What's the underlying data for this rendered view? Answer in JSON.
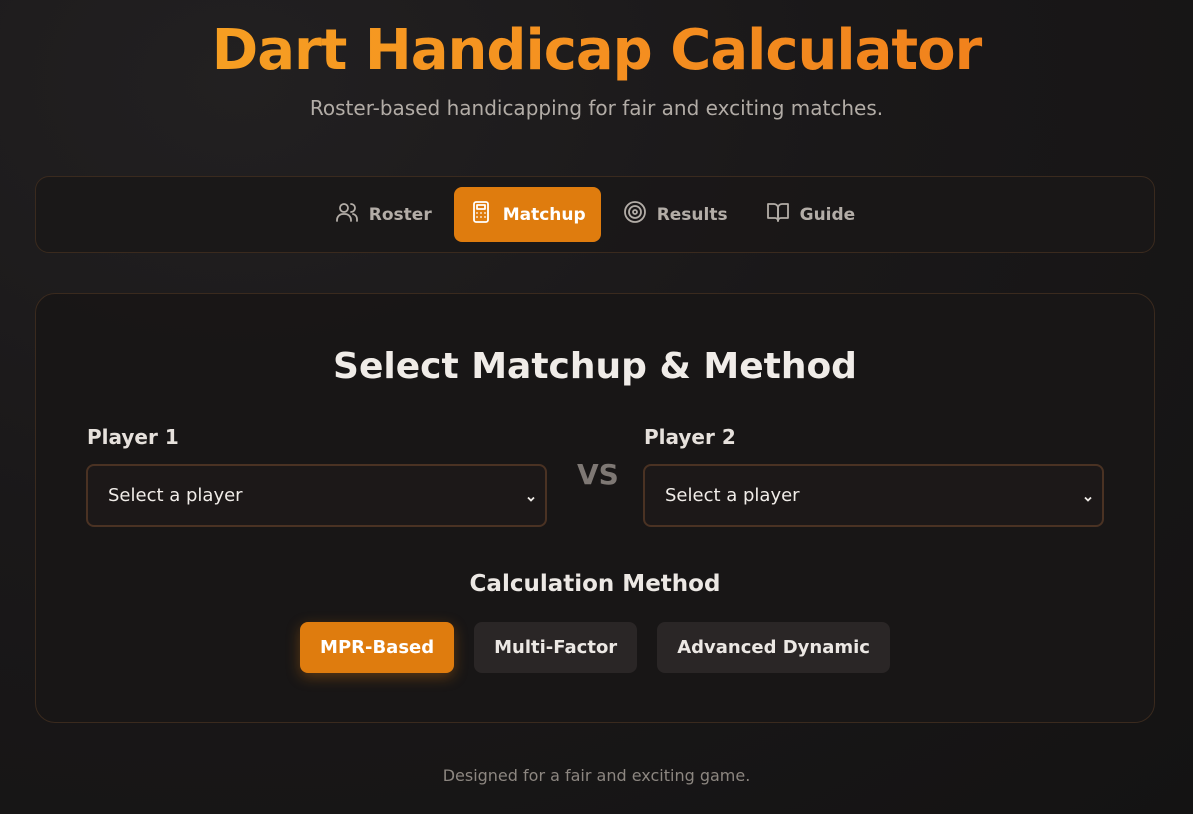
{
  "header": {
    "title": "Dart Handicap Calculator",
    "subtitle": "Roster-based handicapping for fair and exciting matches."
  },
  "nav": {
    "tabs": [
      {
        "label": "Roster",
        "icon": "users-icon",
        "active": false
      },
      {
        "label": "Matchup",
        "icon": "calculator-icon",
        "active": true
      },
      {
        "label": "Results",
        "icon": "target-icon",
        "active": false
      },
      {
        "label": "Guide",
        "icon": "book-open-icon",
        "active": false
      }
    ]
  },
  "matchup": {
    "title": "Select Matchup & Method",
    "player1": {
      "label": "Player 1",
      "value": "Select a player"
    },
    "vs": "VS",
    "player2": {
      "label": "Player 2",
      "value": "Select a player"
    },
    "method_title": "Calculation Method",
    "methods": [
      {
        "label": "MPR-Based",
        "active": true
      },
      {
        "label": "Multi-Factor",
        "active": false
      },
      {
        "label": "Advanced Dynamic",
        "active": false
      }
    ]
  },
  "footer": {
    "text": "Designed for a fair and exciting game."
  },
  "colors": {
    "accent": "#df7c0e",
    "title_gradient_start": "#f6a623",
    "title_gradient_end": "#ee7a1a"
  }
}
